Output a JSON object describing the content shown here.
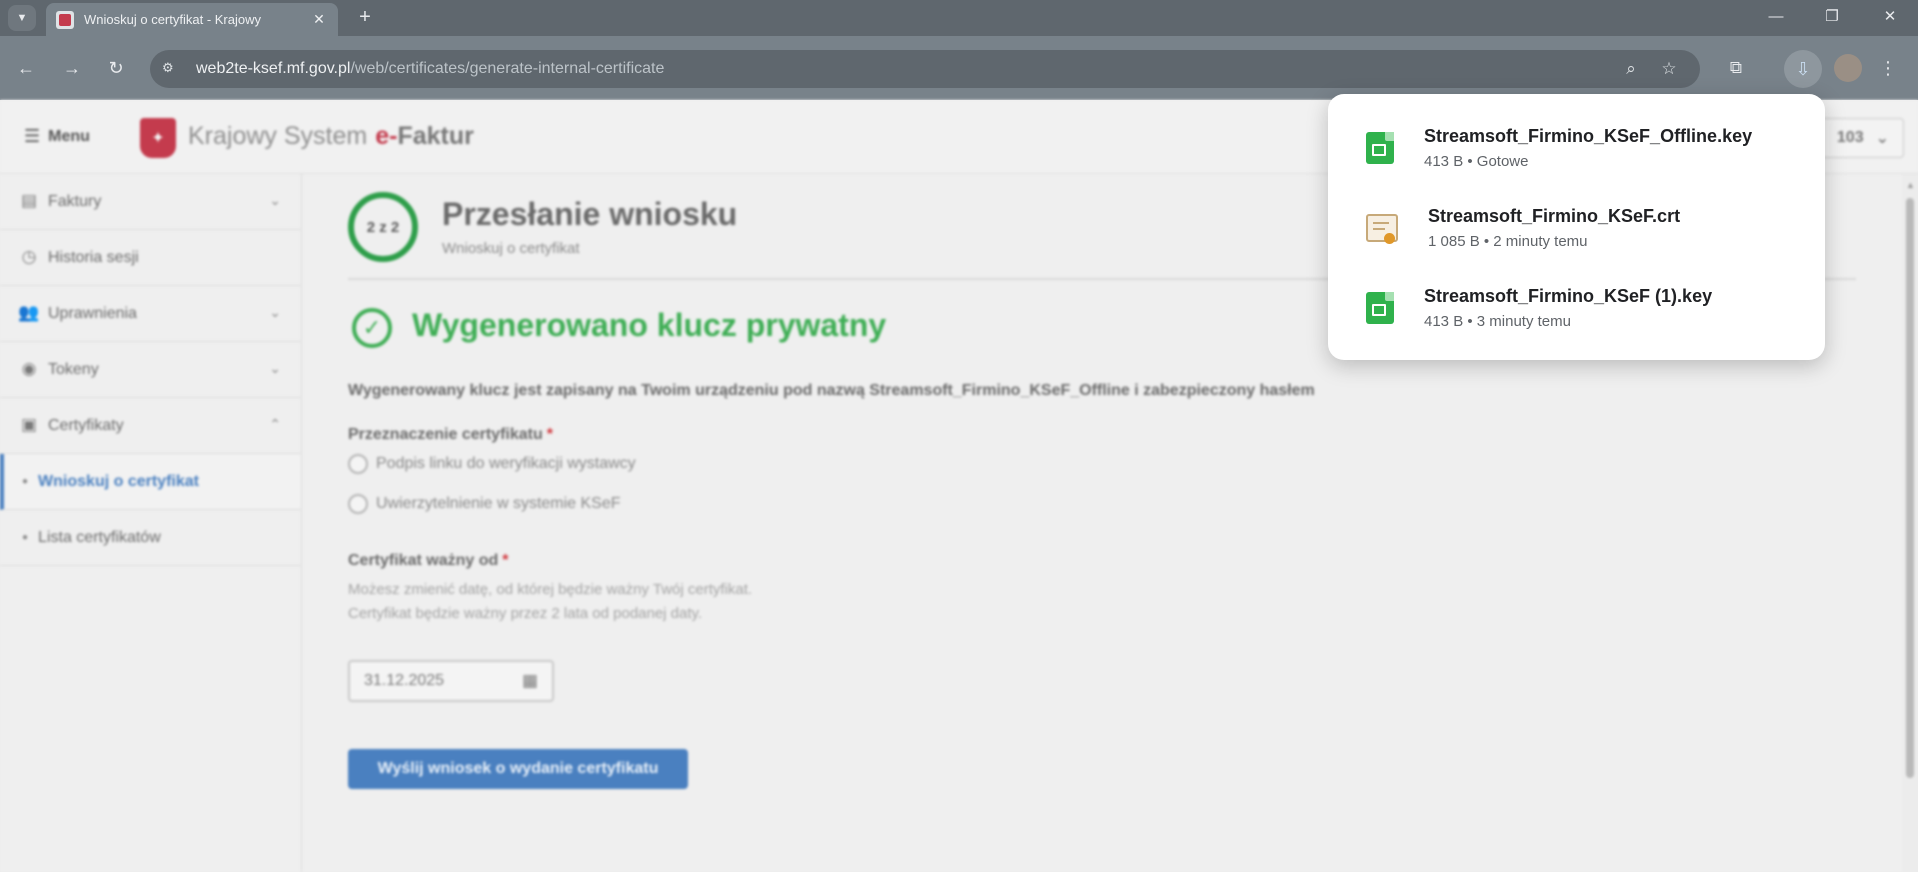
{
  "browser": {
    "tab_title": "Wnioskuj o certyfikat - Krajowy",
    "url_host": "web2te-ksef.mf.gov.pl",
    "url_path": "/web/certificates/generate-internal-certificate"
  },
  "header": {
    "menu_label": "Menu",
    "brand_main": "Krajowy System",
    "brand_e": "e-",
    "brand_bold": "Faktur",
    "context_value": "103"
  },
  "sidebar": {
    "items": [
      {
        "label": "Faktury",
        "icon": "document-icon"
      },
      {
        "label": "Historia sesji",
        "icon": "clock-icon"
      },
      {
        "label": "Uprawnienia",
        "icon": "people-icon"
      },
      {
        "label": "Tokeny",
        "icon": "token-icon"
      },
      {
        "label": "Certyfikaty",
        "icon": "certificate-icon"
      }
    ],
    "sub_items": [
      {
        "label": "Wnioskuj o certyfikat",
        "active": true
      },
      {
        "label": "Lista certyfikatów",
        "active": false
      }
    ]
  },
  "main": {
    "step": "2 z 2",
    "title": "Przesłanie wniosku",
    "subtitle": "Wnioskuj o certyfikat",
    "success_title": "Wygenerowano klucz prywatny",
    "info_text": "Wygenerowany klucz jest zapisany na Twoim urządzeniu pod nazwą Streamsoft_Firmino_KSeF_Offline i zabezpieczony hasłem",
    "purpose_label": "Przeznaczenie certyfikatu",
    "purpose_options": [
      "Podpis linku do weryfikacji wystawcy",
      "Uwierzytelnienie w systemie KSeF"
    ],
    "valid_from_label": "Certyfikat ważny od",
    "valid_from_help": "Możesz zmienić datę, od której będzie ważny Twój certyfikat. Certyfikat będzie ważny przez 2 lata od podanej daty.",
    "valid_from_value": "31.12.2025",
    "required_mark": "*",
    "submit_label": "Wyślij wniosek o wydanie certyfikatu"
  },
  "downloads": [
    {
      "name": "Streamsoft_Firmino_KSeF_Offline.key",
      "meta": "413 B • Gotowe",
      "icon": "key-file-icon"
    },
    {
      "name": "Streamsoft_Firmino_KSeF.crt",
      "meta": "1 085 B • 2 minuty temu",
      "icon": "certificate-file-icon"
    },
    {
      "name": "Streamsoft_Firmino_KSeF (1).key",
      "meta": "413 B • 3 minuty temu",
      "icon": "key-file-icon"
    }
  ],
  "colors": {
    "success": "#3fae55",
    "primary": "#4a80c0",
    "brand_red": "#c43b4d"
  }
}
